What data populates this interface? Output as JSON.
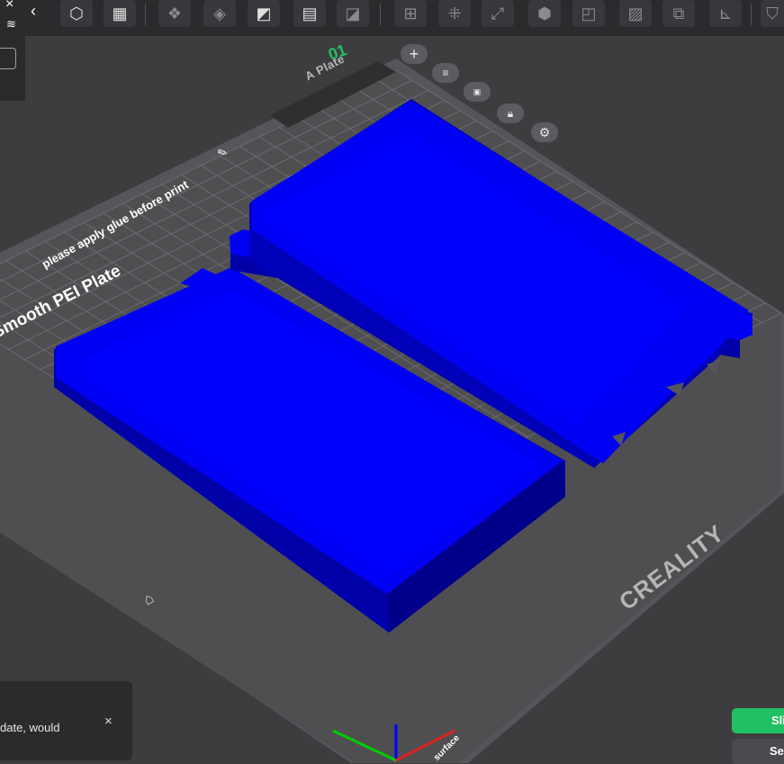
{
  "plate": {
    "number": "01",
    "name": "A Plate",
    "note": "please apply glue before print",
    "type": "Smooth PEI Plate",
    "brand": "CREALITY",
    "surface_label": "surface"
  },
  "notification": {
    "text": "date, would",
    "close_label": "×"
  },
  "actions": {
    "slice_label": "Sli",
    "send_label": "Se"
  },
  "left_panel": {
    "collapse_label": "‹",
    "close_label": "×"
  },
  "colors": {
    "model": "#0000f5",
    "model_side": "#0000b8",
    "model_dark": "#00008a",
    "bed": "#4f4f52",
    "grid_line": "#6c6c70",
    "accent": "#21c063"
  },
  "toolbar_icons": [
    "add-part-icon",
    "add-plate-icon",
    "arrange-icon",
    "orient-icon",
    "auto-orient-icon",
    "layout-icon",
    "paint-icon",
    "cut-icon",
    "split-icon",
    "scale-icon",
    "box-icon",
    "hollow-icon",
    "slice-view-icon",
    "combine-icon",
    "measure-icon",
    "support-icon"
  ]
}
